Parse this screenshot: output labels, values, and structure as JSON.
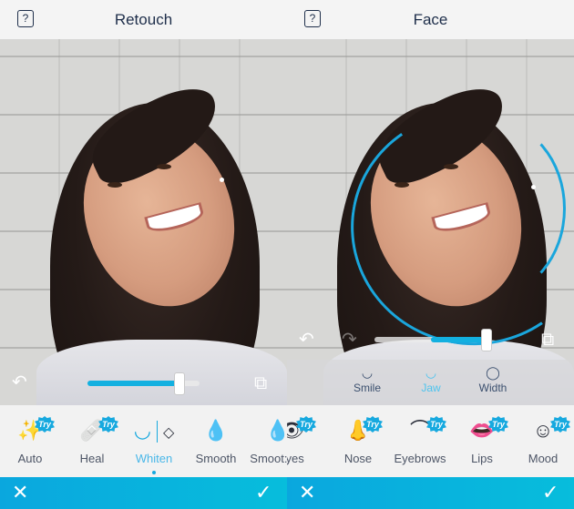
{
  "left": {
    "header": {
      "title": "Retouch",
      "help_label": "?"
    },
    "controls": {
      "undo_icon": "↶",
      "compare_icon": "⧉",
      "slider_value": 0.82
    },
    "tools": [
      {
        "label": "Auto",
        "icon": "magic-wand",
        "glyph": "✨",
        "try": true
      },
      {
        "label": "Heal",
        "icon": "bandage",
        "glyph": "🩹",
        "try": true
      },
      {
        "label": "Whiten",
        "icon": "teeth",
        "glyph": "◡",
        "active": true,
        "secondary_icon": "eraser"
      },
      {
        "label": "Smooth",
        "icon": "drop",
        "glyph": "💧",
        "try": false
      },
      {
        "label": "Smoot:yes",
        "icon": "drops-eye",
        "glyph": "💧",
        "try": true
      }
    ],
    "try_badge": "Try",
    "bottom": {
      "cancel_icon": "✕",
      "confirm_icon": "✓"
    }
  },
  "right": {
    "header": {
      "title": "Face",
      "help_label": "?"
    },
    "controls": {
      "undo_icon": "↶",
      "redo_icon": "↷",
      "compare_icon": "⧉",
      "slider_value": 0.5,
      "slider_fill_start": 0.5,
      "slider_fill_end": 1.0
    },
    "subtools": [
      {
        "label": "Smile",
        "icon": "smile-lips",
        "glyph": "◡"
      },
      {
        "label": "Jaw",
        "icon": "jaw",
        "glyph": "◡",
        "active": true
      },
      {
        "label": "Width",
        "icon": "face-width",
        "glyph": "◯"
      }
    ],
    "tools": [
      {
        "label": "t:yes",
        "icon": "eye",
        "glyph": "👁",
        "try": true
      },
      {
        "label": "Nose",
        "icon": "nose",
        "glyph": "👃",
        "try": true
      },
      {
        "label": "Eyebrows",
        "icon": "eyebrow",
        "glyph": "⌒",
        "try": true
      },
      {
        "label": "Lips",
        "icon": "lips",
        "glyph": "👄",
        "try": true
      },
      {
        "label": "Mood",
        "icon": "mood-face",
        "glyph": "☺",
        "try": true
      }
    ],
    "try_badge": "Try",
    "bottom": {
      "cancel_icon": "✕",
      "confirm_icon": "✓"
    }
  },
  "colors": {
    "accent": "#13b0e0",
    "bottom_bar": "#0aa7de",
    "title_text": "#1e2e4a"
  }
}
